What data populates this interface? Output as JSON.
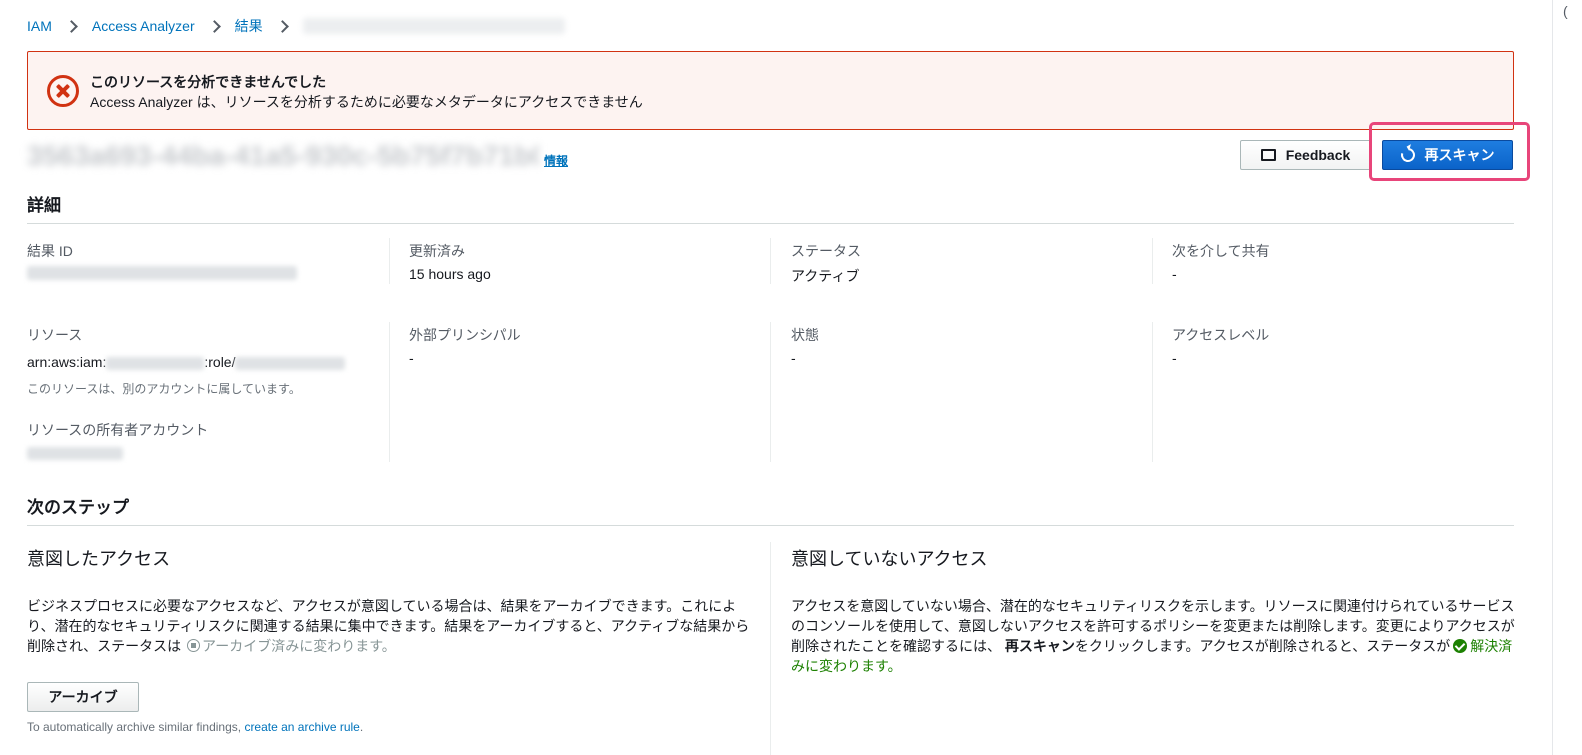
{
  "breadcrumb": {
    "items": [
      "IAM",
      "Access Analyzer",
      "結果"
    ],
    "current_redacted": "0f3ca89e-xxxx-xxxx-xxxx-xxxxxxxxxxxx"
  },
  "alert": {
    "title": "このリソースを分析できませんでした",
    "message": "Access Analyzer は、リソースを分析するために必要なメタデータにアクセスできません"
  },
  "header": {
    "finding_id_redacted": "3563a693-44ba-41a5-930c-5b75f7b71b0",
    "info_link": "情報",
    "feedback_button": "Feedback",
    "rescan_button": "再スキャン"
  },
  "details": {
    "section_title": "詳細",
    "finding_id": {
      "label": "結果 ID",
      "value_redacted": "3563a693-44ba-41a5-930c-5b75f7b71b0"
    },
    "updated": {
      "label": "更新済み",
      "value": "15 hours ago"
    },
    "status": {
      "label": "ステータス",
      "value": "アクティブ"
    },
    "shared_through": {
      "label": "次を介して共有",
      "value": "-"
    },
    "resource": {
      "label": "リソース",
      "prefix": "arn:aws:iam:",
      "middle": ":role/",
      "note": "このリソースは、別のアカウントに属しています。"
    },
    "external_principal": {
      "label": "外部プリンシパル",
      "value": "-"
    },
    "condition": {
      "label": "状態",
      "value": "-"
    },
    "access_level": {
      "label": "アクセスレベル",
      "value": "-"
    },
    "resource_owner": {
      "label": "リソースの所有者アカウント",
      "value_redacted": "000000000000"
    }
  },
  "next_steps": {
    "section_title": "次のステップ",
    "intended": {
      "title": "意図したアクセス",
      "text": "ビジネスプロセスに必要なアクセスなど、アクセスが意図している場合は、結果をアーカイブできます。これにより、潜在的なセキュリティリスクに関連する結果に集中できます。結果をアーカイブすると、アクティブな結果から削除され、ステータスは",
      "status_name": "アーカイブ済み",
      "text_end": "に変わります。",
      "archive_button": "アーカイブ",
      "footnote_prefix": "To automatically archive similar findings,",
      "footnote_link": "create an archive rule",
      "footnote_suffix": "."
    },
    "unintended": {
      "title": "意図していないアクセス",
      "text": "アクセスを意図していない場合、潜在的なセキュリティリスクを示します。リソースに関連付けられているサービスのコンソールを使用して、意図しないアクセスを許可するポリシーを変更または削除します。変更によりアクセスが削除されたことを確認するには、",
      "rescan_bold": "再スキャン",
      "text_mid": "をクリックします。アクセスが削除されると、ステータスが",
      "resolved": "解決済みに変わります。"
    }
  },
  "colors": {
    "link": "#0073bb",
    "error": "#d13212",
    "primary_button": "#0b63c9",
    "highlight": "#e8457a",
    "success": "#1d8102"
  }
}
